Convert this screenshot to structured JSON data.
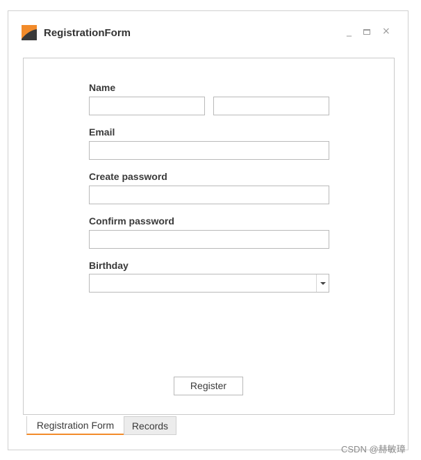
{
  "window": {
    "title": "RegistrationForm",
    "minimize_glyph": "_",
    "close_glyph": "×"
  },
  "form": {
    "name_label": "Name",
    "first_name_value": "",
    "last_name_value": "",
    "email_label": "Email",
    "email_value": "",
    "create_password_label": "Create password",
    "create_password_value": "",
    "confirm_password_label": "Confirm password",
    "confirm_password_value": "",
    "birthday_label": "Birthday",
    "birthday_value": "",
    "register_label": "Register"
  },
  "tabs": [
    {
      "label": "Registration Form",
      "active": true
    },
    {
      "label": "Records",
      "active": false
    }
  ],
  "watermark": "CSDN @赫敏璋",
  "colors": {
    "accent": "#f28b2a",
    "logo_dark": "#333333",
    "border": "#b9b9b9"
  },
  "icons": {
    "app_logo": "app-logo-icon",
    "minimize": "minimize-icon",
    "maximize": "maximize-icon",
    "close": "close-icon",
    "dropdown": "chevron-down-icon"
  }
}
